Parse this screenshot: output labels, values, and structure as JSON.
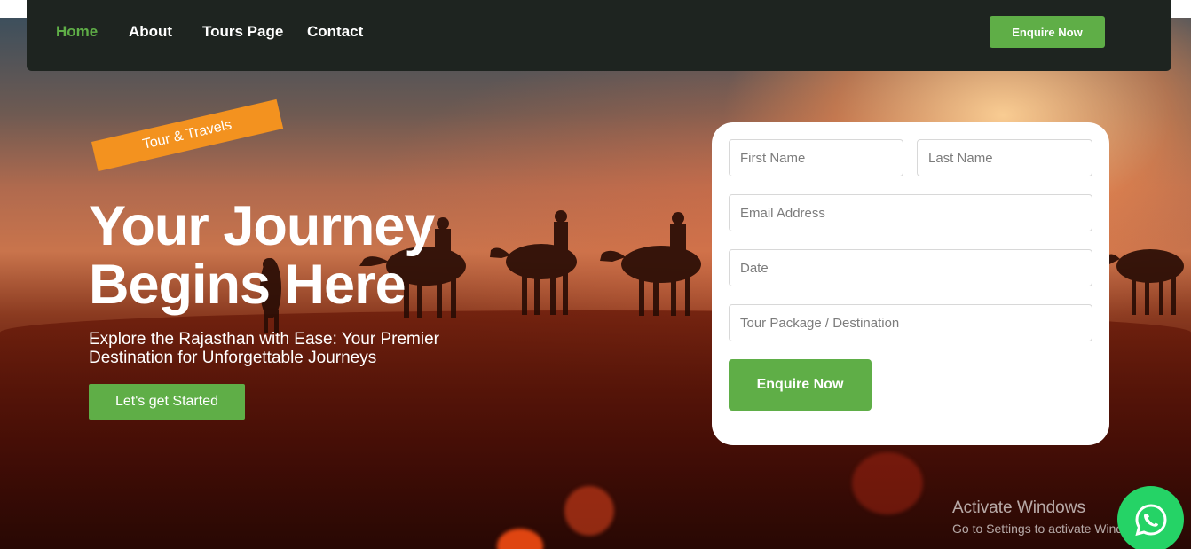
{
  "nav": {
    "links": [
      "Home",
      "About",
      "Tours Page",
      "Contact"
    ],
    "active": "Home",
    "enquire_label": "Enquire Now"
  },
  "hero": {
    "tag": "Tour & Travels",
    "title_line1": "Your Journey",
    "title_line2": "Begins Here",
    "subtitle": "Explore the Rajasthan with Ease: Your Premier Destination for Unforgettable Journeys",
    "cta_label": "Let's get Started"
  },
  "form": {
    "first_name_placeholder": "First Name",
    "last_name_placeholder": "Last Name",
    "email_placeholder": "Email Address",
    "date_placeholder": "Date",
    "package_placeholder": "Tour Package / Destination",
    "submit_label": "Enquire Now"
  },
  "watermark": {
    "title": "Activate Windows",
    "subtitle": "Go to Settings to activate Windows."
  },
  "icons": {
    "whatsapp": "whatsapp-icon"
  },
  "colors": {
    "accent_green": "#5fae47",
    "tag_orange": "#f3921f",
    "nav_bg": "#1e2420",
    "whatsapp_green": "#25d366"
  }
}
